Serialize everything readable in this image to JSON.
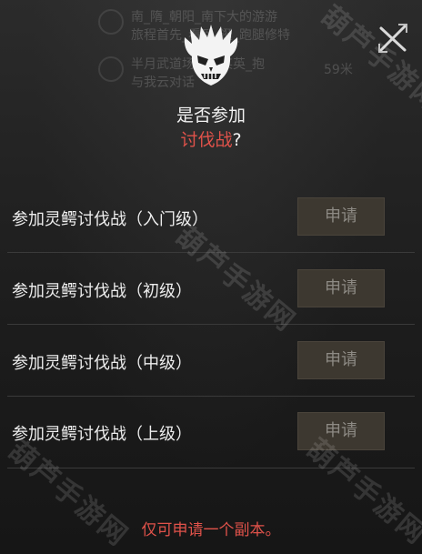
{
  "background_log": {
    "rows": [
      {
        "line1": "南_隋_朝阳_南下大的游游",
        "line2": "旅程首先_看到_逛_跑腿修特"
      },
      {
        "line1": "半月武道场_新_某英_抱",
        "line2": "与我云对话"
      }
    ],
    "distance": "59米"
  },
  "dialog": {
    "question_line1": "是否参加",
    "question_accent": "讨伐战",
    "question_end": "?"
  },
  "options": [
    {
      "label": "参加灵鳄讨伐战（入门级）",
      "button": "申请"
    },
    {
      "label": "参加灵鳄讨伐战（初级）",
      "button": "申请"
    },
    {
      "label": "参加灵鳄讨伐战（中级）",
      "button": "申请"
    },
    {
      "label": "参加灵鳄讨伐战（上级）",
      "button": "申请"
    }
  ],
  "note": "仅可申请一个副本。",
  "watermark": "葫芦手游网",
  "colors": {
    "accent": "#e0524a",
    "button_bg": "#3d3830",
    "button_text": "#8d8a84"
  },
  "icons": {
    "close": "close-icon",
    "emblem": "demon-mask-icon"
  }
}
